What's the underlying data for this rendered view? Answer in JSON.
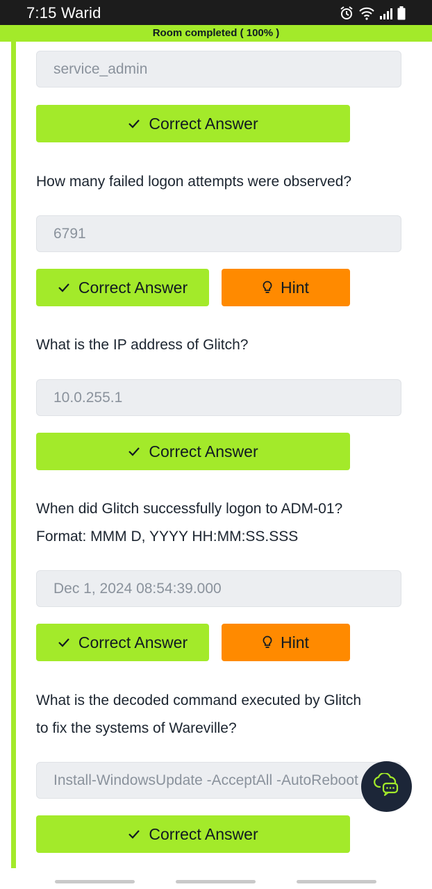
{
  "status_bar": {
    "time": "7:15",
    "carrier": "Warid",
    "icons": [
      "alarm-icon",
      "wifi-icon",
      "signal-icon",
      "battery-icon"
    ]
  },
  "room": {
    "banner": "Room completed ( 100% )",
    "progress_percent": 100
  },
  "questions": [
    {
      "answer": "service_admin",
      "button_label": "Correct Answer"
    },
    {
      "question": "How many failed logon attempts were observed?",
      "answer": "6791",
      "button_label": "Correct Answer",
      "hint_label": "Hint"
    },
    {
      "question": "What is the IP address of Glitch?",
      "answer": "10.0.255.1",
      "button_label": "Correct Answer"
    },
    {
      "question_line1": "When did Glitch successfully logon to ADM-01?",
      "question_line2": "Format: MMM D, YYYY HH:MM:SS.SSS",
      "answer": "Dec 1, 2024 08:54:39.000",
      "button_label": "Correct Answer",
      "hint_label": "Hint"
    },
    {
      "question_line1": "What is the decoded command executed by Glitch",
      "question_line2": "to fix the systems of Wareville?",
      "answer": "Install-WindowsUpdate -AcceptAll -AutoReboot",
      "button_label": "Correct Answer"
    }
  ],
  "colors": {
    "accent_green": "#a3ea2a",
    "hint_orange": "#ff8a00",
    "fab_navy": "#1c2638"
  },
  "chat": {
    "icon": "chat-cloud-icon"
  }
}
